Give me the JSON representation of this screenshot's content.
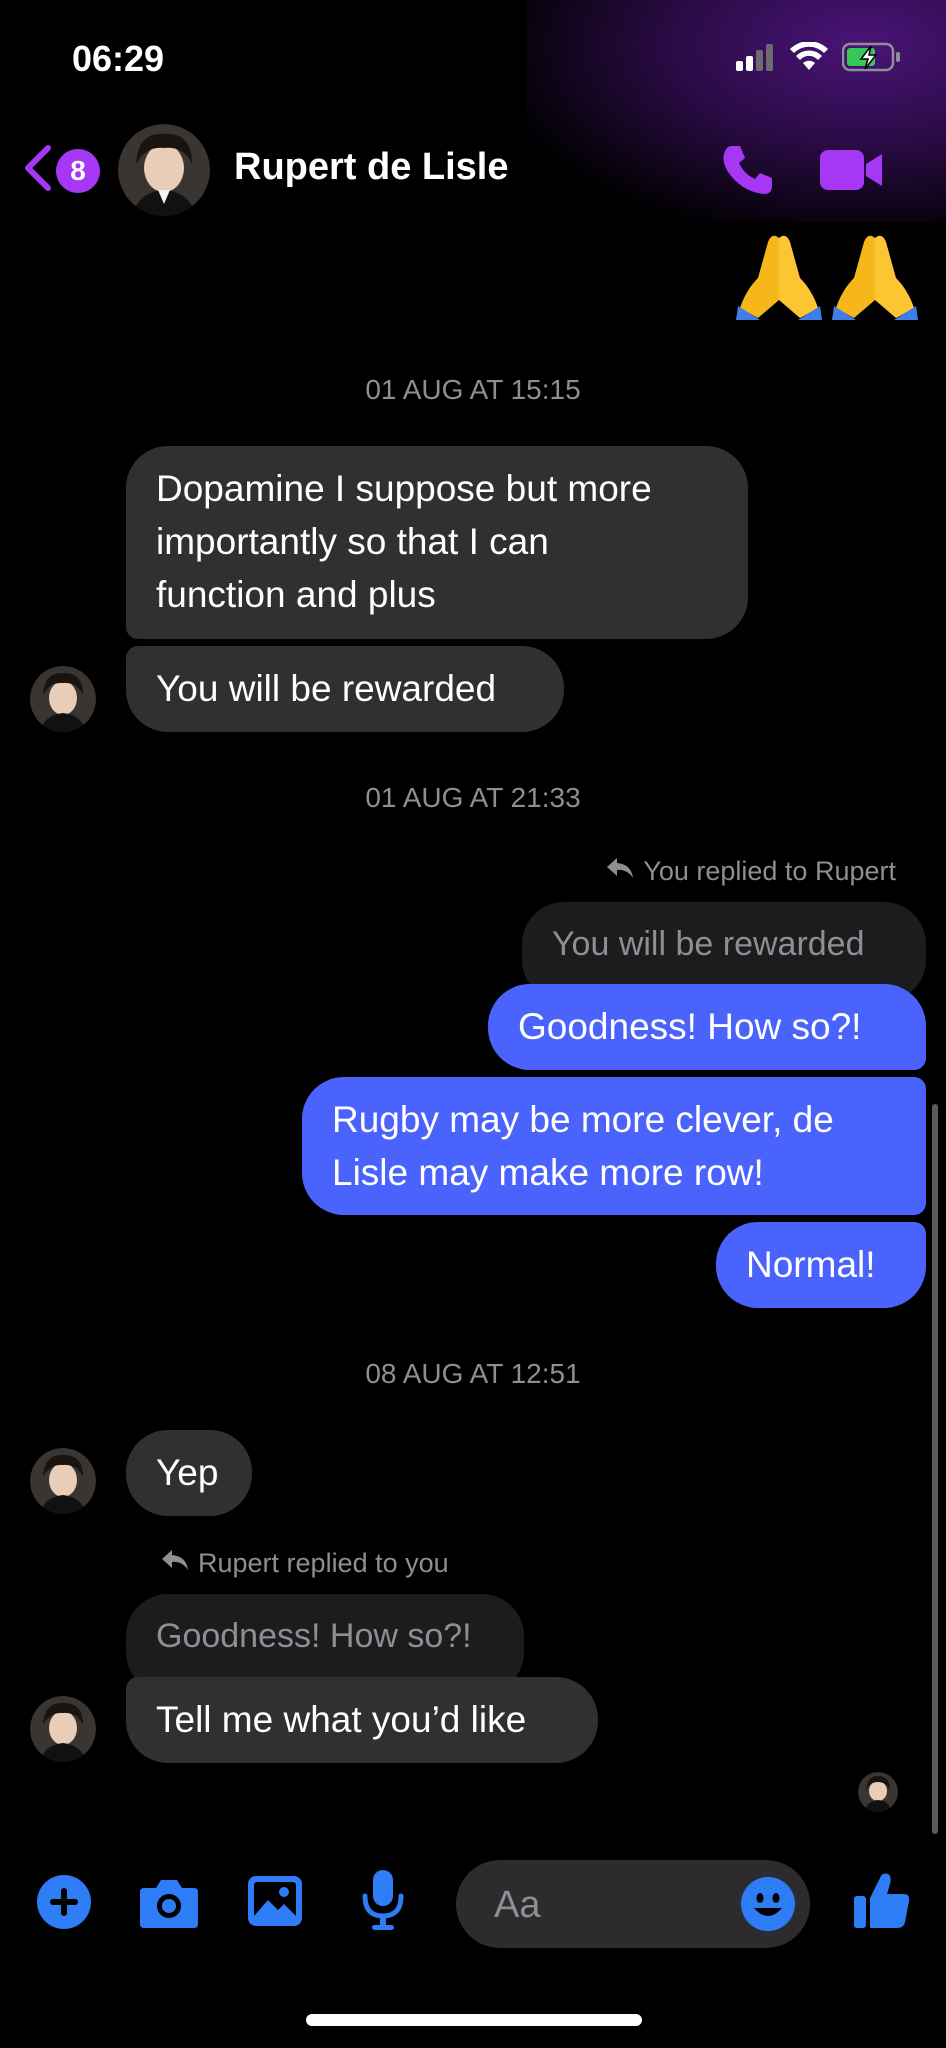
{
  "status_bar": {
    "time": "06:29",
    "icons": [
      "signal-icon",
      "wifi-icon",
      "battery-charging-icon"
    ]
  },
  "header": {
    "back_badge_count": "8",
    "contact_name": "Rupert de Lisle",
    "avatar": "contact-avatar",
    "actions": [
      "phone-call-icon",
      "video-call-icon"
    ]
  },
  "conversation": {
    "top_emojis": [
      "🙏",
      "🙏"
    ],
    "timestamps": [
      "01 AUG AT 15:15",
      "01 AUG AT 21:33",
      "08 AUG AT 12:51"
    ],
    "group1": [
      "Dopamine I suppose but more",
      "importantly so that I can",
      "function and plus",
      "You will be rewarded"
    ],
    "reply_out": {
      "label": "You replied to Rupert",
      "quoted": "You will be rewarded",
      "text": "Goodness! How so?!"
    },
    "out_messages": [
      "Rugby may be more clever, de",
      "Lisle may make more row!",
      "Normal!"
    ],
    "yep": "Yep",
    "reply_in": {
      "label": "Rupert replied to you",
      "quoted": "Goodness! How so?!",
      "text": "Tell me what you’d like"
    }
  },
  "composer": {
    "placeholder": "Aa",
    "actions": [
      "plus-icon",
      "camera-icon",
      "gallery-icon",
      "microphone-icon",
      "emoji-icon",
      "thumbs-up-icon"
    ]
  },
  "colors": {
    "accent_purple": "#a537f5",
    "accent_blue": "#2e7cf6",
    "outgoing_bubble": "#4b63fd",
    "incoming_bubble": "#303030",
    "background": "#000000"
  }
}
